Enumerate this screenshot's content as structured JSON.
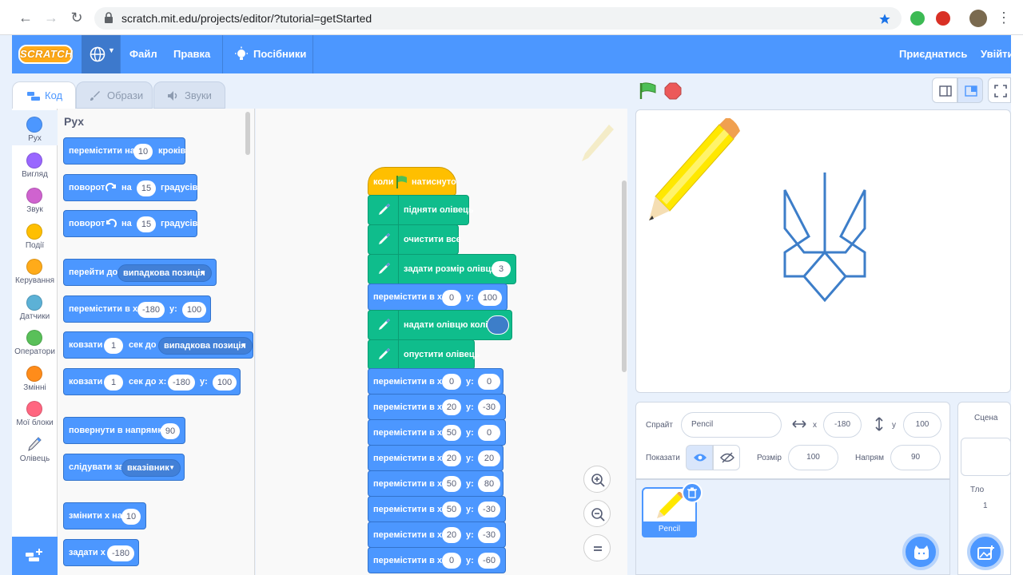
{
  "browser": {
    "url": "scratch.mit.edu/projects/editor/?tutorial=getStarted"
  },
  "menu": {
    "logo": "SCRATCH",
    "file": "Файл",
    "edit": "Правка",
    "tutorials": "Посібники",
    "join": "Приєднатись",
    "sign_in": "Увійти"
  },
  "tabs": {
    "code": "Код",
    "costumes": "Образи",
    "sounds": "Звуки"
  },
  "categories": [
    {
      "label": "Рух",
      "color": "#4c97ff"
    },
    {
      "label": "Вигляд",
      "color": "#9966ff"
    },
    {
      "label": "Звук",
      "color": "#cf63cf"
    },
    {
      "label": "Події",
      "color": "#ffbf00"
    },
    {
      "label": "Керування",
      "color": "#ffab19"
    },
    {
      "label": "Датчики",
      "color": "#5cb1d6"
    },
    {
      "label": "Оператори",
      "color": "#59c059"
    },
    {
      "label": "Змінні",
      "color": "#ff8c1a"
    },
    {
      "label": "Мої блоки",
      "color": "#ff6680"
    },
    {
      "label": "Олівець",
      "color": "#0fbd8c"
    }
  ],
  "palette": {
    "title": "Рух",
    "move": {
      "a": "перемістити на",
      "n": "10",
      "b": "кроків"
    },
    "turn_right": {
      "a": "поворот",
      "b": "на",
      "n": "15",
      "c": "градусів"
    },
    "turn_left": {
      "a": "поворот",
      "b": "на",
      "n": "15",
      "c": "градусів"
    },
    "goto": {
      "a": "перейти до",
      "dd": "випадкова позиція"
    },
    "goto_xy": {
      "a": "перемістити в x:",
      "x": "-180",
      "b": "y:",
      "y": "100"
    },
    "glide_to": {
      "a": "ковзати",
      "n": "1",
      "b": "сек до",
      "dd": "випадкова позиція"
    },
    "glide_xy": {
      "a": "ковзати",
      "n": "1",
      "b": "сек до x:",
      "x": "-180",
      "c": "y:",
      "y": "100"
    },
    "point_dir": {
      "a": "повернути в напрямку",
      "n": "90"
    },
    "point_towards": {
      "a": "слідувати за",
      "dd": "вказівник"
    },
    "change_x": {
      "a": "змінити x на",
      "n": "10"
    },
    "set_x": {
      "a": "задати x",
      "n": "-180"
    }
  },
  "script": {
    "hat": {
      "a": "коли",
      "b": "натиснуто"
    },
    "pen_up": "підняти олівець",
    "clear": "очистити все",
    "set_size": {
      "a": "задати розмір олівця",
      "n": "3"
    },
    "goto1": {
      "a": "перемістити в x:",
      "x": "0",
      "b": "y:",
      "y": "100"
    },
    "set_color": {
      "a": "надати олівцю колір",
      "color": "#3d7ec9"
    },
    "pen_down": "опустити олівець",
    "moves": [
      {
        "a": "перемістити в x:",
        "x": "0",
        "b": "y:",
        "y": "0"
      },
      {
        "a": "перемістити в x:",
        "x": "20",
        "b": "y:",
        "y": "-30"
      },
      {
        "a": "перемістити в x:",
        "x": "50",
        "b": "y:",
        "y": "0"
      },
      {
        "a": "перемістити в x:",
        "x": "20",
        "b": "y:",
        "y": "20"
      },
      {
        "a": "перемістити в x:",
        "x": "50",
        "b": "y:",
        "y": "80"
      },
      {
        "a": "перемістити в x:",
        "x": "50",
        "b": "y:",
        "y": "-30"
      },
      {
        "a": "перемістити в x:",
        "x": "20",
        "b": "y:",
        "y": "-30"
      },
      {
        "a": "перемістити в x:",
        "x": "0",
        "b": "y:",
        "y": "-60"
      }
    ]
  },
  "sprite_info": {
    "sprite_label": "Спрайт",
    "sprite_name": "Pencil",
    "x_label": "x",
    "x_value": "-180",
    "y_label": "y",
    "y_value": "100",
    "show_label": "Показати",
    "size_label": "Розмір",
    "size_value": "100",
    "direction_label": "Напрям",
    "direction_value": "90"
  },
  "sprites": [
    {
      "name": "Pencil"
    }
  ],
  "stage_selector": {
    "title": "Сцена",
    "backdrops_label": "Тло",
    "backdrops_count": "1"
  },
  "colors": {
    "motion": "#4c97ff",
    "pen": "#0fbd8c",
    "event": "#ffbf00",
    "menu": "#4c97ff",
    "trident": "#3d7ec9"
  }
}
